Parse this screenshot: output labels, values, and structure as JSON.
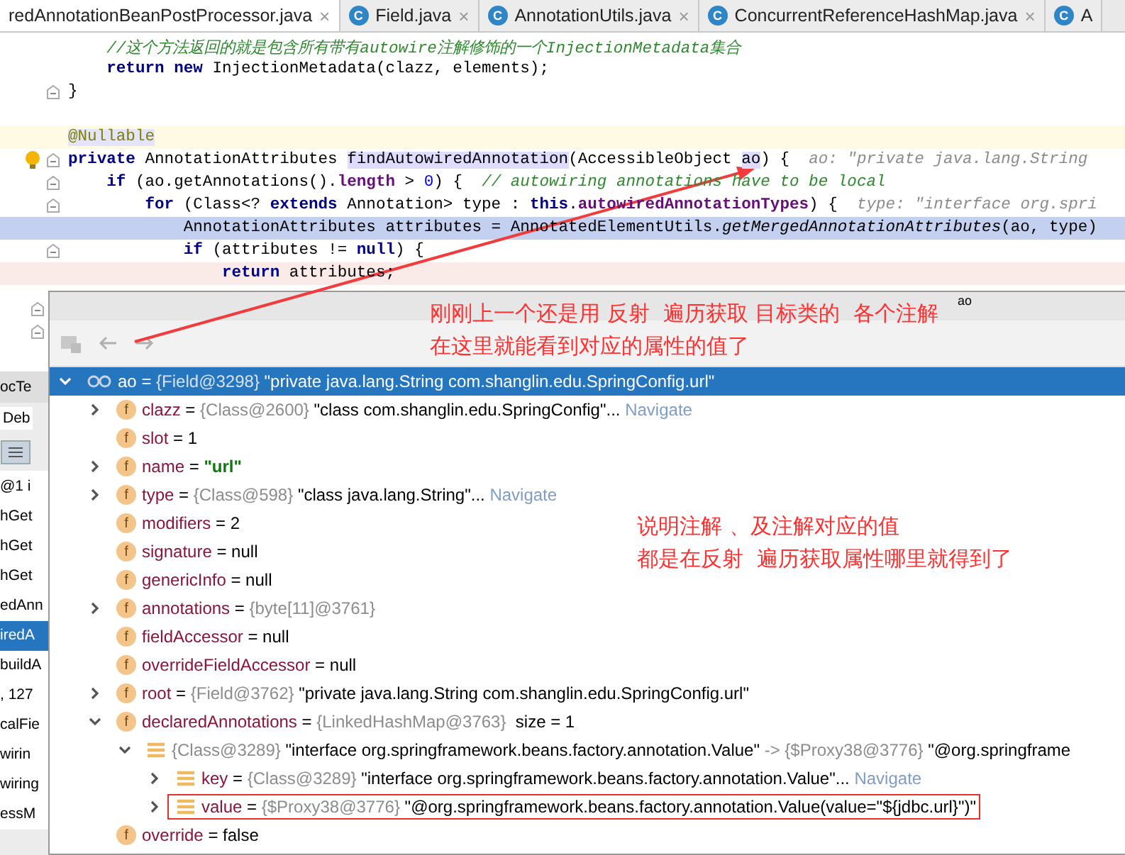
{
  "tabs": [
    {
      "label": "redAnnotationBeanPostProcessor.java",
      "selected": true,
      "close": "×"
    },
    {
      "label": "Field.java",
      "selected": false,
      "close": "×",
      "icon_text": "C"
    },
    {
      "label": "AnnotationUtils.java",
      "selected": false,
      "close": "×",
      "icon_text": "C"
    },
    {
      "label": "ConcurrentReferenceHashMap.java",
      "selected": false,
      "close": "×",
      "icon_text": "C"
    },
    {
      "label": "A",
      "selected": false,
      "icon_text": "C"
    }
  ],
  "code": [
    {
      "kind": "plain",
      "fold": false,
      "bulb": false,
      "tokens": [
        {
          "kind": "comment",
          "text": "    //这个方法返回的就是包含所有带有autowire注解修饰的一个InjectionMetadata集合"
        }
      ]
    },
    {
      "kind": "plain",
      "fold": false,
      "bulb": false,
      "tokens": [
        {
          "kind": "kw",
          "text": "    return new"
        },
        {
          "kind": "plain",
          "text": " InjectionMetadata(clazz, elements);"
        }
      ]
    },
    {
      "kind": "plain",
      "fold": true,
      "bulb": false,
      "tokens": [
        {
          "kind": "plain",
          "text": "}"
        }
      ]
    },
    {
      "kind": "plain",
      "fold": false,
      "bulb": false
    },
    {
      "kind": "caret",
      "fold": false,
      "bulb": false,
      "tokens": [
        {
          "kind": "annotation",
          "text": "@Nullable"
        }
      ]
    },
    {
      "kind": "plain",
      "fold": true,
      "bulb": true,
      "tokens": [
        {
          "kind": "kw",
          "text": "private"
        },
        {
          "kind": "plain",
          "text": " AnnotationAttributes "
        },
        {
          "kind": "usage",
          "text": "findAutowiredAnnotation"
        },
        {
          "kind": "plain",
          "text": "(AccessibleObject "
        },
        {
          "kind": "usage",
          "text": "ao"
        },
        {
          "kind": "plain",
          "text": ") {  "
        },
        {
          "kind": "hint",
          "text": "ao: \"private java.lang.String"
        }
      ]
    },
    {
      "kind": "plain",
      "fold": true,
      "bulb": false,
      "tokens": [
        {
          "kind": "kw",
          "text": "    if"
        },
        {
          "kind": "plain",
          "text": " (ao.getAnnotations()."
        },
        {
          "kind": "field",
          "text": "length"
        },
        {
          "kind": "plain",
          "text": " > "
        },
        {
          "kind": "number",
          "text": "0"
        },
        {
          "kind": "plain",
          "text": ") {  "
        },
        {
          "kind": "comment",
          "text": "// autowiring annotations have to be local"
        }
      ]
    },
    {
      "kind": "plain",
      "fold": true,
      "bulb": false,
      "tokens": [
        {
          "kind": "kw",
          "text": "        for"
        },
        {
          "kind": "plain",
          "text": " (Class<? "
        },
        {
          "kind": "kw",
          "text": "extends"
        },
        {
          "kind": "plain",
          "text": " Annotation> type : "
        },
        {
          "kind": "kw",
          "text": "this"
        },
        {
          "kind": "plain",
          "text": "."
        },
        {
          "kind": "field",
          "text": "autowiredAnnotationTypes"
        },
        {
          "kind": "plain",
          "text": ") {  "
        },
        {
          "kind": "hint",
          "text": "type: \"interface org.spri"
        }
      ]
    },
    {
      "kind": "current",
      "fold": false,
      "bulb": false,
      "tokens": [
        {
          "kind": "plain",
          "text": "            AnnotationAttributes attributes = AnnotatedElementUtils."
        },
        {
          "kind": "static",
          "text": "getMergedAnnotationAttributes"
        },
        {
          "kind": "plain",
          "text": "(ao, type)"
        }
      ]
    },
    {
      "kind": "plain",
      "fold": true,
      "bulb": false,
      "tokens": [
        {
          "kind": "kw",
          "text": "            if"
        },
        {
          "kind": "plain",
          "text": " (attributes != "
        },
        {
          "kind": "kw",
          "text": "null"
        },
        {
          "kind": "plain",
          "text": ") {"
        }
      ]
    },
    {
      "kind": "breakpoint",
      "fold": false,
      "bulb": false,
      "tokens": [
        {
          "kind": "kw",
          "text": "                return"
        },
        {
          "kind": "plain",
          "text": " attributes;"
        }
      ]
    }
  ],
  "left_panel": {
    "title": "ocTe",
    "tab": "Deb",
    "frame": "@1 i",
    "frames": [
      {
        "label": "hGet",
        "selected": false
      },
      {
        "label": "hGet",
        "selected": false
      },
      {
        "label": "hGet",
        "selected": false
      },
      {
        "label": "edAnn",
        "selected": false
      },
      {
        "label": "iredA",
        "selected": true
      },
      {
        "label": "buildA",
        "selected": false
      },
      {
        "label": ", 127",
        "selected": false
      },
      {
        "label": "calFie",
        "selected": false
      },
      {
        "label": "wirin",
        "selected": false
      },
      {
        "label": "wiring",
        "selected": false
      },
      {
        "label": "essM",
        "selected": false
      }
    ]
  },
  "popup": {
    "title": "ao",
    "notes": [
      {
        "lines": [
          "刚刚上一个还是用 反射  遍历获取 目标类的  各个注解",
          "在这里就能看到对应的属性的值了"
        ]
      },
      {
        "lines": [
          "说明注解 、及注解对应的值",
          "都是在反射  遍历获取属性哪里就得到了"
        ]
      }
    ],
    "tree": [
      {
        "kind": "watch",
        "selected": true,
        "expandable": true,
        "expanded": true,
        "boxed": false,
        "segments": [
          {
            "kind": "name",
            "text": "ao"
          },
          {
            "kind": "op",
            "text": " = "
          },
          {
            "kind": "ref",
            "text": "{Field@3298}"
          },
          {
            "kind": "text",
            "text": " \"private java.lang.String com.shanglin.edu.SpringConfig.url\""
          }
        ],
        "children": [
          {
            "kind": "field",
            "icon_text": "f",
            "selected": false,
            "expandable": true,
            "expanded": false,
            "boxed": false,
            "segments": [
              {
                "kind": "name",
                "text": "clazz"
              },
              {
                "kind": "op",
                "text": " = "
              },
              {
                "kind": "ref",
                "text": "{Class@2600}"
              },
              {
                "kind": "text",
                "text": " \"class com.shanglin.edu.SpringConfig\"..."
              },
              {
                "kind": "link",
                "text": " Navigate"
              }
            ]
          },
          {
            "kind": "field",
            "icon_text": "f",
            "selected": false,
            "expandable": false,
            "expanded": false,
            "boxed": false,
            "segments": [
              {
                "kind": "name",
                "text": "slot"
              },
              {
                "kind": "op",
                "text": " = 1"
              }
            ]
          },
          {
            "kind": "field",
            "icon_text": "f",
            "selected": false,
            "expandable": true,
            "expanded": false,
            "boxed": false,
            "segments": [
              {
                "kind": "name",
                "text": "name"
              },
              {
                "kind": "op",
                "text": " = "
              },
              {
                "kind": "string",
                "text": "\"url\""
              }
            ]
          },
          {
            "kind": "field",
            "icon_text": "f",
            "selected": false,
            "expandable": true,
            "expanded": false,
            "boxed": false,
            "segments": [
              {
                "kind": "name",
                "text": "type"
              },
              {
                "kind": "op",
                "text": " = "
              },
              {
                "kind": "ref",
                "text": "{Class@598}"
              },
              {
                "kind": "text",
                "text": " \"class java.lang.String\"..."
              },
              {
                "kind": "link",
                "text": " Navigate"
              }
            ]
          },
          {
            "kind": "field",
            "icon_text": "f",
            "selected": false,
            "expandable": false,
            "expanded": false,
            "boxed": false,
            "segments": [
              {
                "kind": "name",
                "text": "modifiers"
              },
              {
                "kind": "op",
                "text": " = 2"
              }
            ]
          },
          {
            "kind": "field",
            "icon_text": "f",
            "selected": false,
            "expandable": false,
            "expanded": false,
            "boxed": false,
            "segments": [
              {
                "kind": "name",
                "text": "signature"
              },
              {
                "kind": "op",
                "text": " = null"
              }
            ]
          },
          {
            "kind": "field",
            "icon_text": "f",
            "selected": false,
            "expandable": false,
            "expanded": false,
            "boxed": false,
            "segments": [
              {
                "kind": "name",
                "text": "genericInfo"
              },
              {
                "kind": "op",
                "text": " = null"
              }
            ]
          },
          {
            "kind": "field",
            "icon_text": "f",
            "selected": false,
            "expandable": true,
            "expanded": false,
            "boxed": false,
            "segments": [
              {
                "kind": "name",
                "text": "annotations"
              },
              {
                "kind": "op",
                "text": " = "
              },
              {
                "kind": "ref",
                "text": "{byte[11]@3761}"
              }
            ]
          },
          {
            "kind": "field",
            "icon_text": "f",
            "selected": false,
            "expandable": false,
            "expanded": false,
            "boxed": false,
            "segments": [
              {
                "kind": "name",
                "text": "fieldAccessor"
              },
              {
                "kind": "op",
                "text": " = null"
              }
            ]
          },
          {
            "kind": "field",
            "icon_text": "f",
            "selected": false,
            "expandable": false,
            "expanded": false,
            "boxed": false,
            "segments": [
              {
                "kind": "name",
                "text": "overrideFieldAccessor"
              },
              {
                "kind": "op",
                "text": " = null"
              }
            ]
          },
          {
            "kind": "field",
            "icon_text": "f",
            "selected": false,
            "expandable": true,
            "expanded": false,
            "boxed": false,
            "segments": [
              {
                "kind": "name",
                "text": "root"
              },
              {
                "kind": "op",
                "text": " = "
              },
              {
                "kind": "ref",
                "text": "{Field@3762}"
              },
              {
                "kind": "text",
                "text": " \"private java.lang.String com.shanglin.edu.SpringConfig.url\""
              }
            ]
          },
          {
            "kind": "field",
            "icon_text": "f",
            "selected": false,
            "expandable": true,
            "expanded": true,
            "boxed": false,
            "segments": [
              {
                "kind": "name",
                "text": "declaredAnnotations"
              },
              {
                "kind": "op",
                "text": " = "
              },
              {
                "kind": "ref",
                "text": "{LinkedHashMap@3763}"
              },
              {
                "kind": "text",
                "text": "  size = 1"
              }
            ],
            "children": [
              {
                "kind": "entry",
                "selected": false,
                "expandable": true,
                "expanded": true,
                "boxed": false,
                "segments": [
                  {
                    "kind": "ref",
                    "text": "{Class@3289}"
                  },
                  {
                    "kind": "text",
                    "text": " \"interface org.springframework.beans.factory.annotation.Value\""
                  },
                  {
                    "kind": "ref",
                    "text": " -> {$Proxy38@3776}"
                  },
                  {
                    "kind": "text",
                    "text": " \"@org.springframe"
                  }
                ],
                "children": [
                  {
                    "kind": "entry",
                    "selected": false,
                    "expandable": true,
                    "expanded": false,
                    "boxed": false,
                    "segments": [
                      {
                        "kind": "name",
                        "text": "key"
                      },
                      {
                        "kind": "op",
                        "text": " = "
                      },
                      {
                        "kind": "ref",
                        "text": "{Class@3289}"
                      },
                      {
                        "kind": "text",
                        "text": " \"interface org.springframework.beans.factory.annotation.Value\"..."
                      },
                      {
                        "kind": "link",
                        "text": " Navigate"
                      }
                    ]
                  },
                  {
                    "kind": "entry",
                    "selected": false,
                    "expandable": true,
                    "expanded": false,
                    "boxed": true,
                    "segments": [
                      {
                        "kind": "name",
                        "text": "value"
                      },
                      {
                        "kind": "op",
                        "text": " = "
                      },
                      {
                        "kind": "ref",
                        "text": "{$Proxy38@3776}"
                      },
                      {
                        "kind": "text",
                        "text": " \"@org.springframework.beans.factory.annotation.Value(value=\"${jdbc.url}\")\""
                      }
                    ]
                  }
                ]
              }
            ]
          },
          {
            "kind": "field",
            "icon_text": "f",
            "selected": false,
            "expandable": false,
            "expanded": false,
            "boxed": false,
            "segments": [
              {
                "kind": "name",
                "text": "override"
              },
              {
                "kind": "op",
                "text": " = false"
              }
            ]
          }
        ]
      }
    ]
  }
}
